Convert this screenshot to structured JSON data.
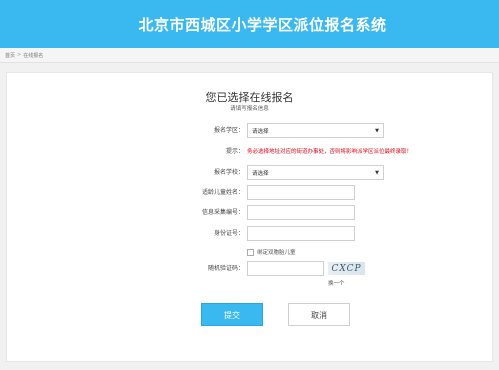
{
  "header": {
    "title": "北京市西城区小学学区派位报名系统"
  },
  "breadcrumb": {
    "home": "首页",
    "separator": ">",
    "current": "在线报名"
  },
  "form": {
    "title": "您已选择在线报名",
    "subtitle": "请填写报名信息",
    "district_label": "报名学区：",
    "district_value": "请选择",
    "hint_label": "提示：",
    "hint_text": "务必选择地址对应的街道办事处，否则将影响派学区派位最终录取！",
    "school_label": "报名学校：",
    "school_value": "请选择",
    "child_name_label": "适龄儿童姓名：",
    "child_name_value": "",
    "info_code_label": "信息采集编号：",
    "info_code_value": "",
    "id_label": "身份证号：",
    "id_value": "",
    "twins_checkbox_label": "绑定双胞胎儿童",
    "captcha_label": "随机验证码：",
    "captcha_value": "",
    "captcha_image_text": "CXCP",
    "captcha_refresh": "换一个",
    "submit_label": "提交",
    "cancel_label": "取消"
  },
  "colors": {
    "header_bg": "#3ab8f0",
    "hint_red": "#e60012",
    "button_blue": "#3ab8f0"
  },
  "icons": {
    "select_arrow": "dropdown-arrow-icon"
  }
}
